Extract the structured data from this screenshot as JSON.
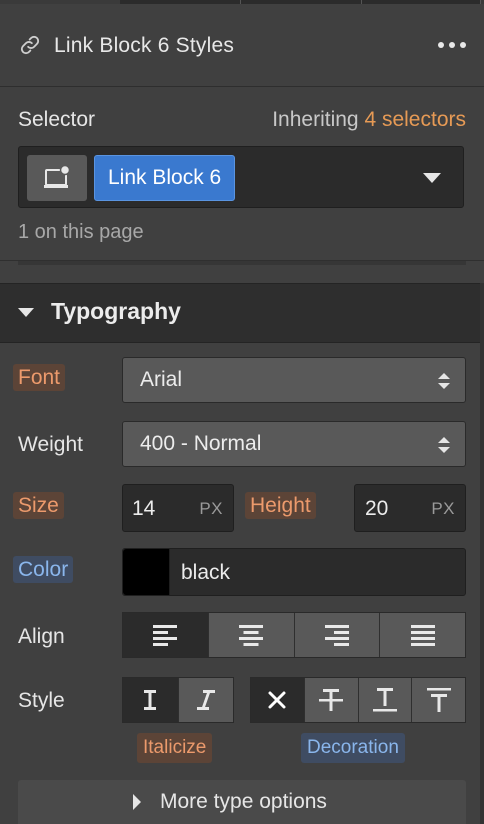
{
  "header": {
    "title": "Link Block 6 Styles"
  },
  "selector": {
    "label": "Selector",
    "inheriting_prefix": "Inheriting",
    "inheriting_count": "4 selectors",
    "chip": "Link Block 6",
    "on_page": "1 on this page"
  },
  "typography": {
    "section_title": "Typography",
    "font": {
      "label": "Font",
      "value": "Arial"
    },
    "weight": {
      "label": "Weight",
      "value": "400 - Normal"
    },
    "size": {
      "label": "Size",
      "value": "14",
      "unit": "PX"
    },
    "height": {
      "label": "Height",
      "value": "20",
      "unit": "PX"
    },
    "color": {
      "label": "Color",
      "value": "black",
      "swatch": "#000000"
    },
    "align": {
      "label": "Align",
      "options": [
        "left",
        "center",
        "right",
        "justify"
      ],
      "selected": "left"
    },
    "style": {
      "label": "Style",
      "italic_options": [
        "regular",
        "italic"
      ],
      "decoration_options": [
        "none",
        "strikethrough",
        "underline",
        "overline"
      ]
    },
    "italicize_tag": "Italicize",
    "decoration_tag": "Decoration",
    "more_label": "More type options"
  },
  "colors": {
    "accent_orange": "#e69a55",
    "chip_blue": "#3a79cf",
    "tag_orange_bg": "#5c4437",
    "tag_blue_bg": "#3f4c62"
  }
}
